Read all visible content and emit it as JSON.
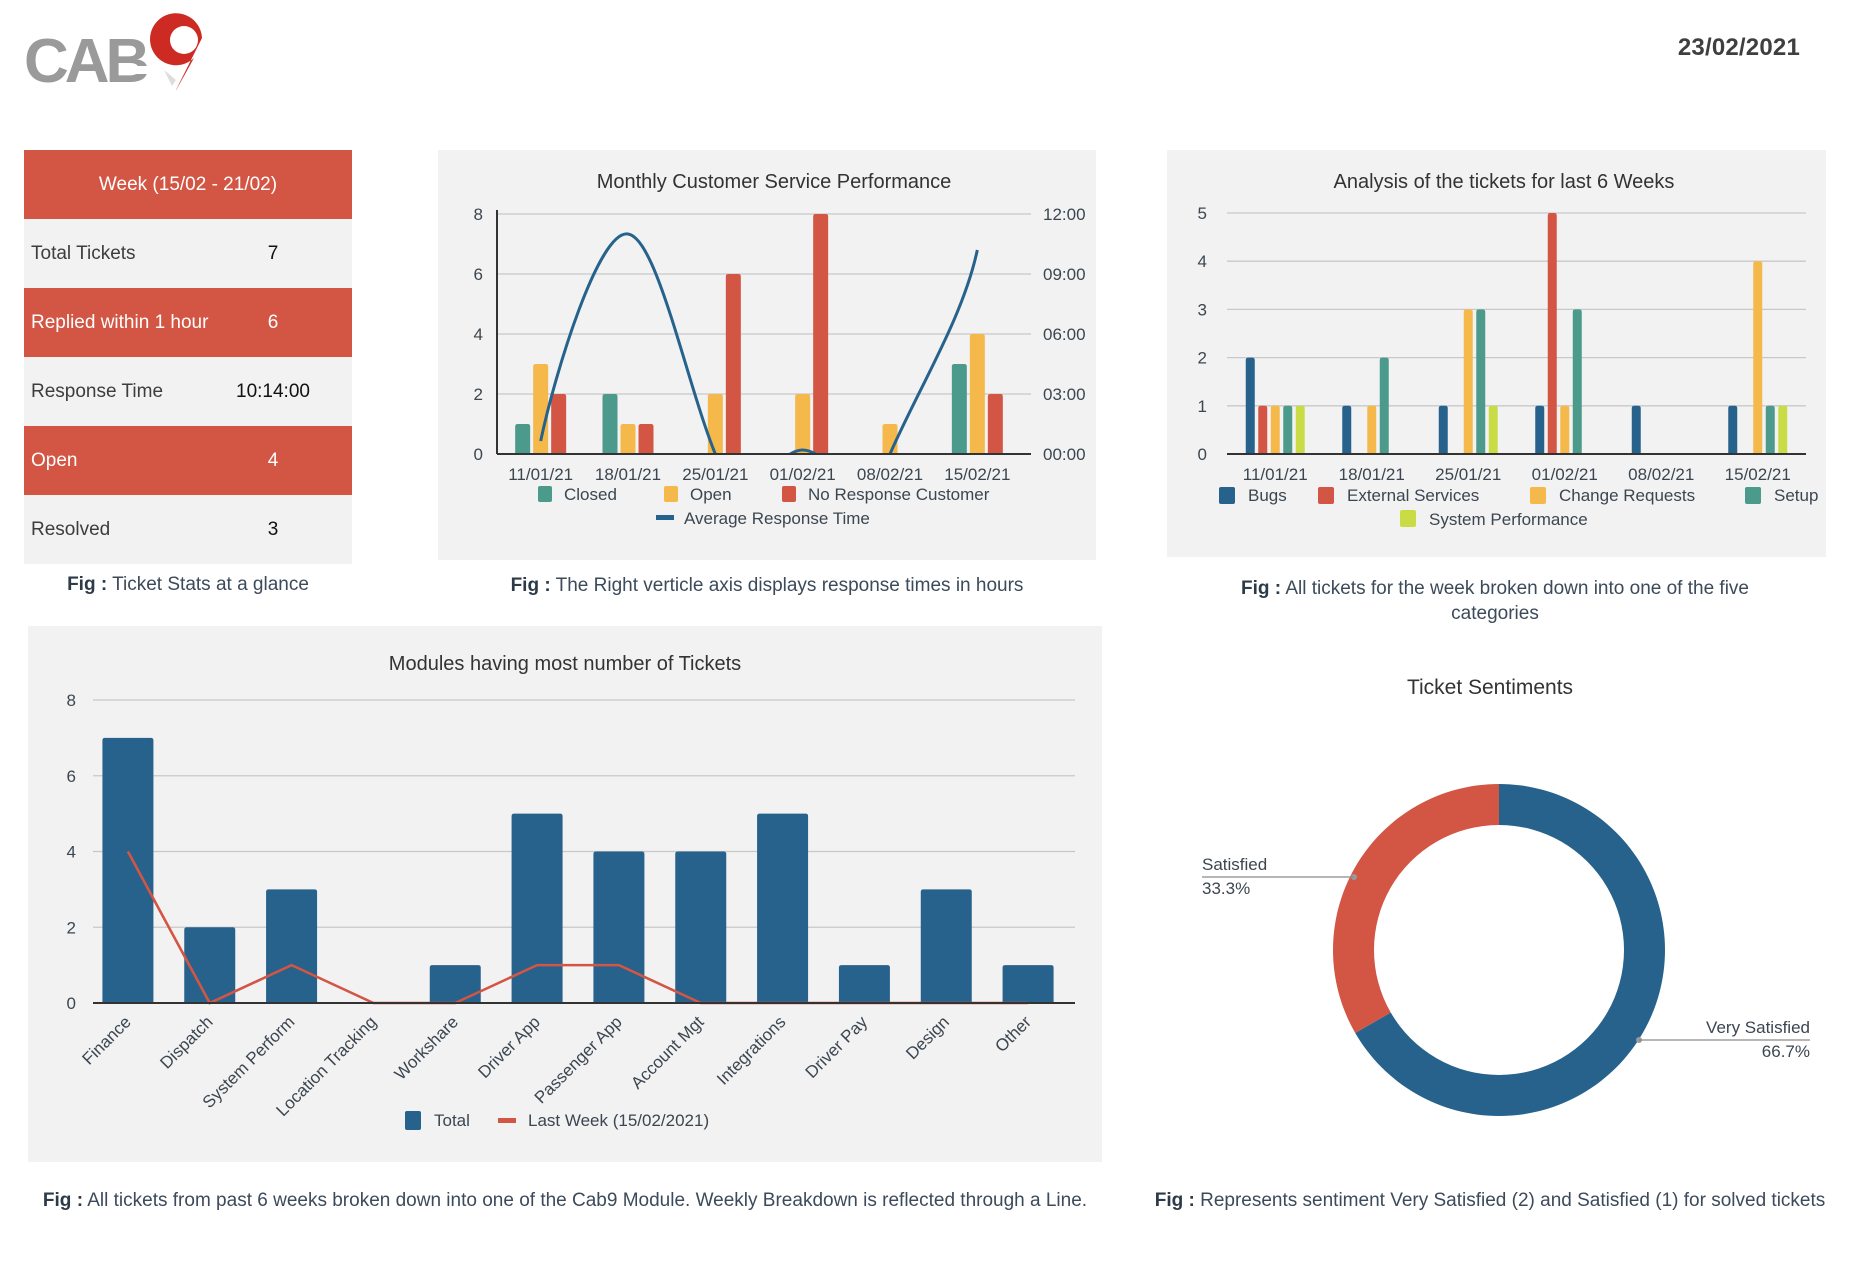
{
  "header": {
    "logo_text": "CAB9",
    "date": "23/02/2021"
  },
  "colors": {
    "blue": "#26628c",
    "red": "#d35543",
    "yellow": "#f4b94a",
    "teal": "#4b9a8c",
    "lime": "#c9dc46",
    "panel": "#f2f2f2"
  },
  "stats": {
    "header": "Week (15/02 - 21/02)",
    "rows": [
      {
        "label": "Total Tickets",
        "value": "7"
      },
      {
        "label": "Replied within 1 hour",
        "value": "6"
      },
      {
        "label": "Response Time",
        "value": "10:14:00"
      },
      {
        "label": "Open",
        "value": "4"
      },
      {
        "label": "Resolved",
        "value": "3"
      }
    ],
    "caption_prefix": "Fig :",
    "caption": " Ticket Stats at a glance"
  },
  "captions": {
    "performance_prefix": "Fig :",
    "performance": " The Right verticle axis displays response times in hours",
    "analysis_prefix": "Fig :",
    "analysis": " All tickets for the week broken down into one of the five categories",
    "modules_prefix": "Fig :",
    "modules": " All tickets from past 6 weeks broken down into one of the Cab9 Module. Weekly Breakdown is reflected through a Line.",
    "sentiment_prefix": "Fig :",
    "sentiment": " Represents sentiment Very Satisfied (2) and Satisfied (1) for solved tickets"
  },
  "chart_data": [
    {
      "id": "performance",
      "type": "bar",
      "title": "Monthly Customer Service Performance",
      "categories": [
        "11/01/21",
        "18/01/21",
        "25/01/21",
        "01/02/21",
        "08/02/21",
        "15/02/21"
      ],
      "ylim": [
        0,
        8
      ],
      "yticks": [
        "0",
        "2",
        "4",
        "6",
        "8"
      ],
      "y2lim_hours": [
        0,
        12
      ],
      "y2ticks": [
        "00:00",
        "03:00",
        "06:00",
        "09:00",
        "12:00"
      ],
      "grid": true,
      "legend_position": "bottom",
      "series": [
        {
          "name": "Closed",
          "kind": "bar",
          "color": "#4b9a8c",
          "values": [
            1,
            2,
            0,
            0,
            0,
            3
          ]
        },
        {
          "name": "Open",
          "kind": "bar",
          "color": "#f4b94a",
          "values": [
            3,
            1,
            2,
            2,
            1,
            4
          ]
        },
        {
          "name": "No Response Customer",
          "kind": "bar",
          "color": "#d35543",
          "values": [
            2,
            1,
            6,
            8,
            0,
            2
          ]
        },
        {
          "name": "Average Response Time",
          "kind": "line",
          "axis": "right",
          "unit": "hours",
          "color": "#26628c",
          "values": [
            0.65,
            11.0,
            0.0,
            0.2,
            0.0,
            10.2
          ]
        }
      ]
    },
    {
      "id": "analysis",
      "type": "bar",
      "title": "Analysis of the tickets for last 6 Weeks",
      "categories": [
        "11/01/21",
        "18/01/21",
        "25/01/21",
        "01/02/21",
        "08/02/21",
        "15/02/21"
      ],
      "ylim": [
        0,
        5
      ],
      "yticks": [
        "0",
        "1",
        "2",
        "3",
        "4",
        "5"
      ],
      "grid": true,
      "legend_position": "bottom",
      "series": [
        {
          "name": "Bugs",
          "color": "#26628c",
          "values": [
            2,
            1,
            1,
            1,
            1,
            1
          ]
        },
        {
          "name": "External Services",
          "color": "#d35543",
          "values": [
            1,
            0,
            0,
            5,
            0,
            0
          ]
        },
        {
          "name": "Change Requests",
          "color": "#f4b94a",
          "values": [
            1,
            1,
            3,
            1,
            0,
            4
          ]
        },
        {
          "name": "Setup",
          "color": "#4b9a8c",
          "values": [
            1,
            2,
            3,
            3,
            0,
            1
          ]
        },
        {
          "name": "System Performance",
          "color": "#c9dc46",
          "values": [
            1,
            0,
            1,
            0,
            0,
            1
          ]
        }
      ]
    },
    {
      "id": "modules",
      "type": "bar",
      "title": "Modules having most number of Tickets",
      "categories": [
        "Finance",
        "Dispatch",
        "System Perform",
        "Location Tracking",
        "Workshare",
        "Driver App",
        "Passenger App",
        "Account Mgt",
        "Integrations",
        "Driver Pay",
        "Design",
        "Other"
      ],
      "ylim": [
        0,
        8
      ],
      "yticks": [
        "0",
        "2",
        "4",
        "6",
        "8"
      ],
      "grid": true,
      "legend_position": "bottom",
      "series": [
        {
          "name": "Total",
          "kind": "bar",
          "color": "#26628c",
          "values": [
            7,
            2,
            3,
            0,
            1,
            5,
            4,
            4,
            5,
            1,
            3,
            1
          ]
        },
        {
          "name": "Last Week (15/02/2021)",
          "kind": "line",
          "color": "#d35543",
          "values": [
            4,
            0,
            1,
            0,
            0,
            1,
            1,
            0,
            0,
            0,
            0,
            0
          ]
        }
      ]
    },
    {
      "id": "sentiment",
      "type": "pie",
      "donut": true,
      "title": "Ticket Sentiments",
      "slices": [
        {
          "label": "Very Satisfied",
          "value": 2,
          "percent": "66.7%",
          "color": "#26628c"
        },
        {
          "label": "Satisfied",
          "value": 1,
          "percent": "33.3%",
          "color": "#d35543"
        }
      ]
    }
  ]
}
